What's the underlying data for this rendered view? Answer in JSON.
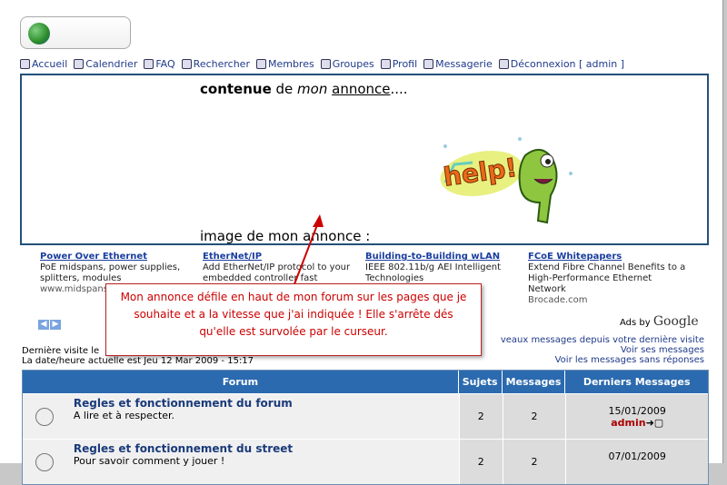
{
  "nav": [
    "Accueil",
    "Calendrier",
    "FAQ",
    "Rechercher",
    "Membres",
    "Groupes",
    "Profil",
    "Messagerie",
    "Déconnexion [ admin ]"
  ],
  "annonce": {
    "t1": "contenue",
    "t2": " de ",
    "t3": "mon",
    "t4": " ",
    "t5": "annonce",
    "t6": "....",
    "caption": "image de mon annonce :",
    "help": "help!"
  },
  "ads": [
    {
      "h": "Power Over Ethernet",
      "d": "PoE midspans, power supplies, splitters, modules",
      "u": "www.midspans"
    },
    {
      "h": "EtherNet/IP",
      "d": "Add EtherNet/IP protocol to your embedded controller fast",
      "u": ""
    },
    {
      "h": "Building-to-Building wLAN",
      "d": "IEEE 802.11b/g AEI Intelligent Technologies",
      "u": ""
    },
    {
      "h": "FCoE Whitepapers",
      "d": "Extend Fibre Channel Benefits to a High-Performance Ethernet Network",
      "u": "Brocade.com"
    }
  ],
  "adsby": "Ads by",
  "google": "Google",
  "lastvisit": "Dernière visite le",
  "curdate": "La date/heure actuelle est Jeu 12 Mar 2009 - 15:17",
  "links": [
    "veaux messages depuis votre dernière visite",
    "Voir ses messages",
    "Voir les messages sans réponses"
  ],
  "table": {
    "headers": [
      "Forum",
      "Sujets",
      "Messages",
      "Derniers Messages"
    ],
    "rows": [
      {
        "name": "Regles et fonctionnement du forum",
        "desc": "A lire et à respecter.",
        "sujets": "2",
        "messages": "2",
        "date": "15/01/2009",
        "user": "admin"
      },
      {
        "name": "Regles et fonctionnement du street",
        "desc": "Pour savoir comment y jouer !",
        "sujets": "2",
        "messages": "2",
        "date": "07/01/2009",
        "user": ""
      }
    ]
  },
  "callout": "Mon annonce défile en haut de mon forum sur les pages que je souhaite et a la vitesse que j'ai indiquée ! Elle s'arrête dés qu'elle est survolée par le curseur."
}
